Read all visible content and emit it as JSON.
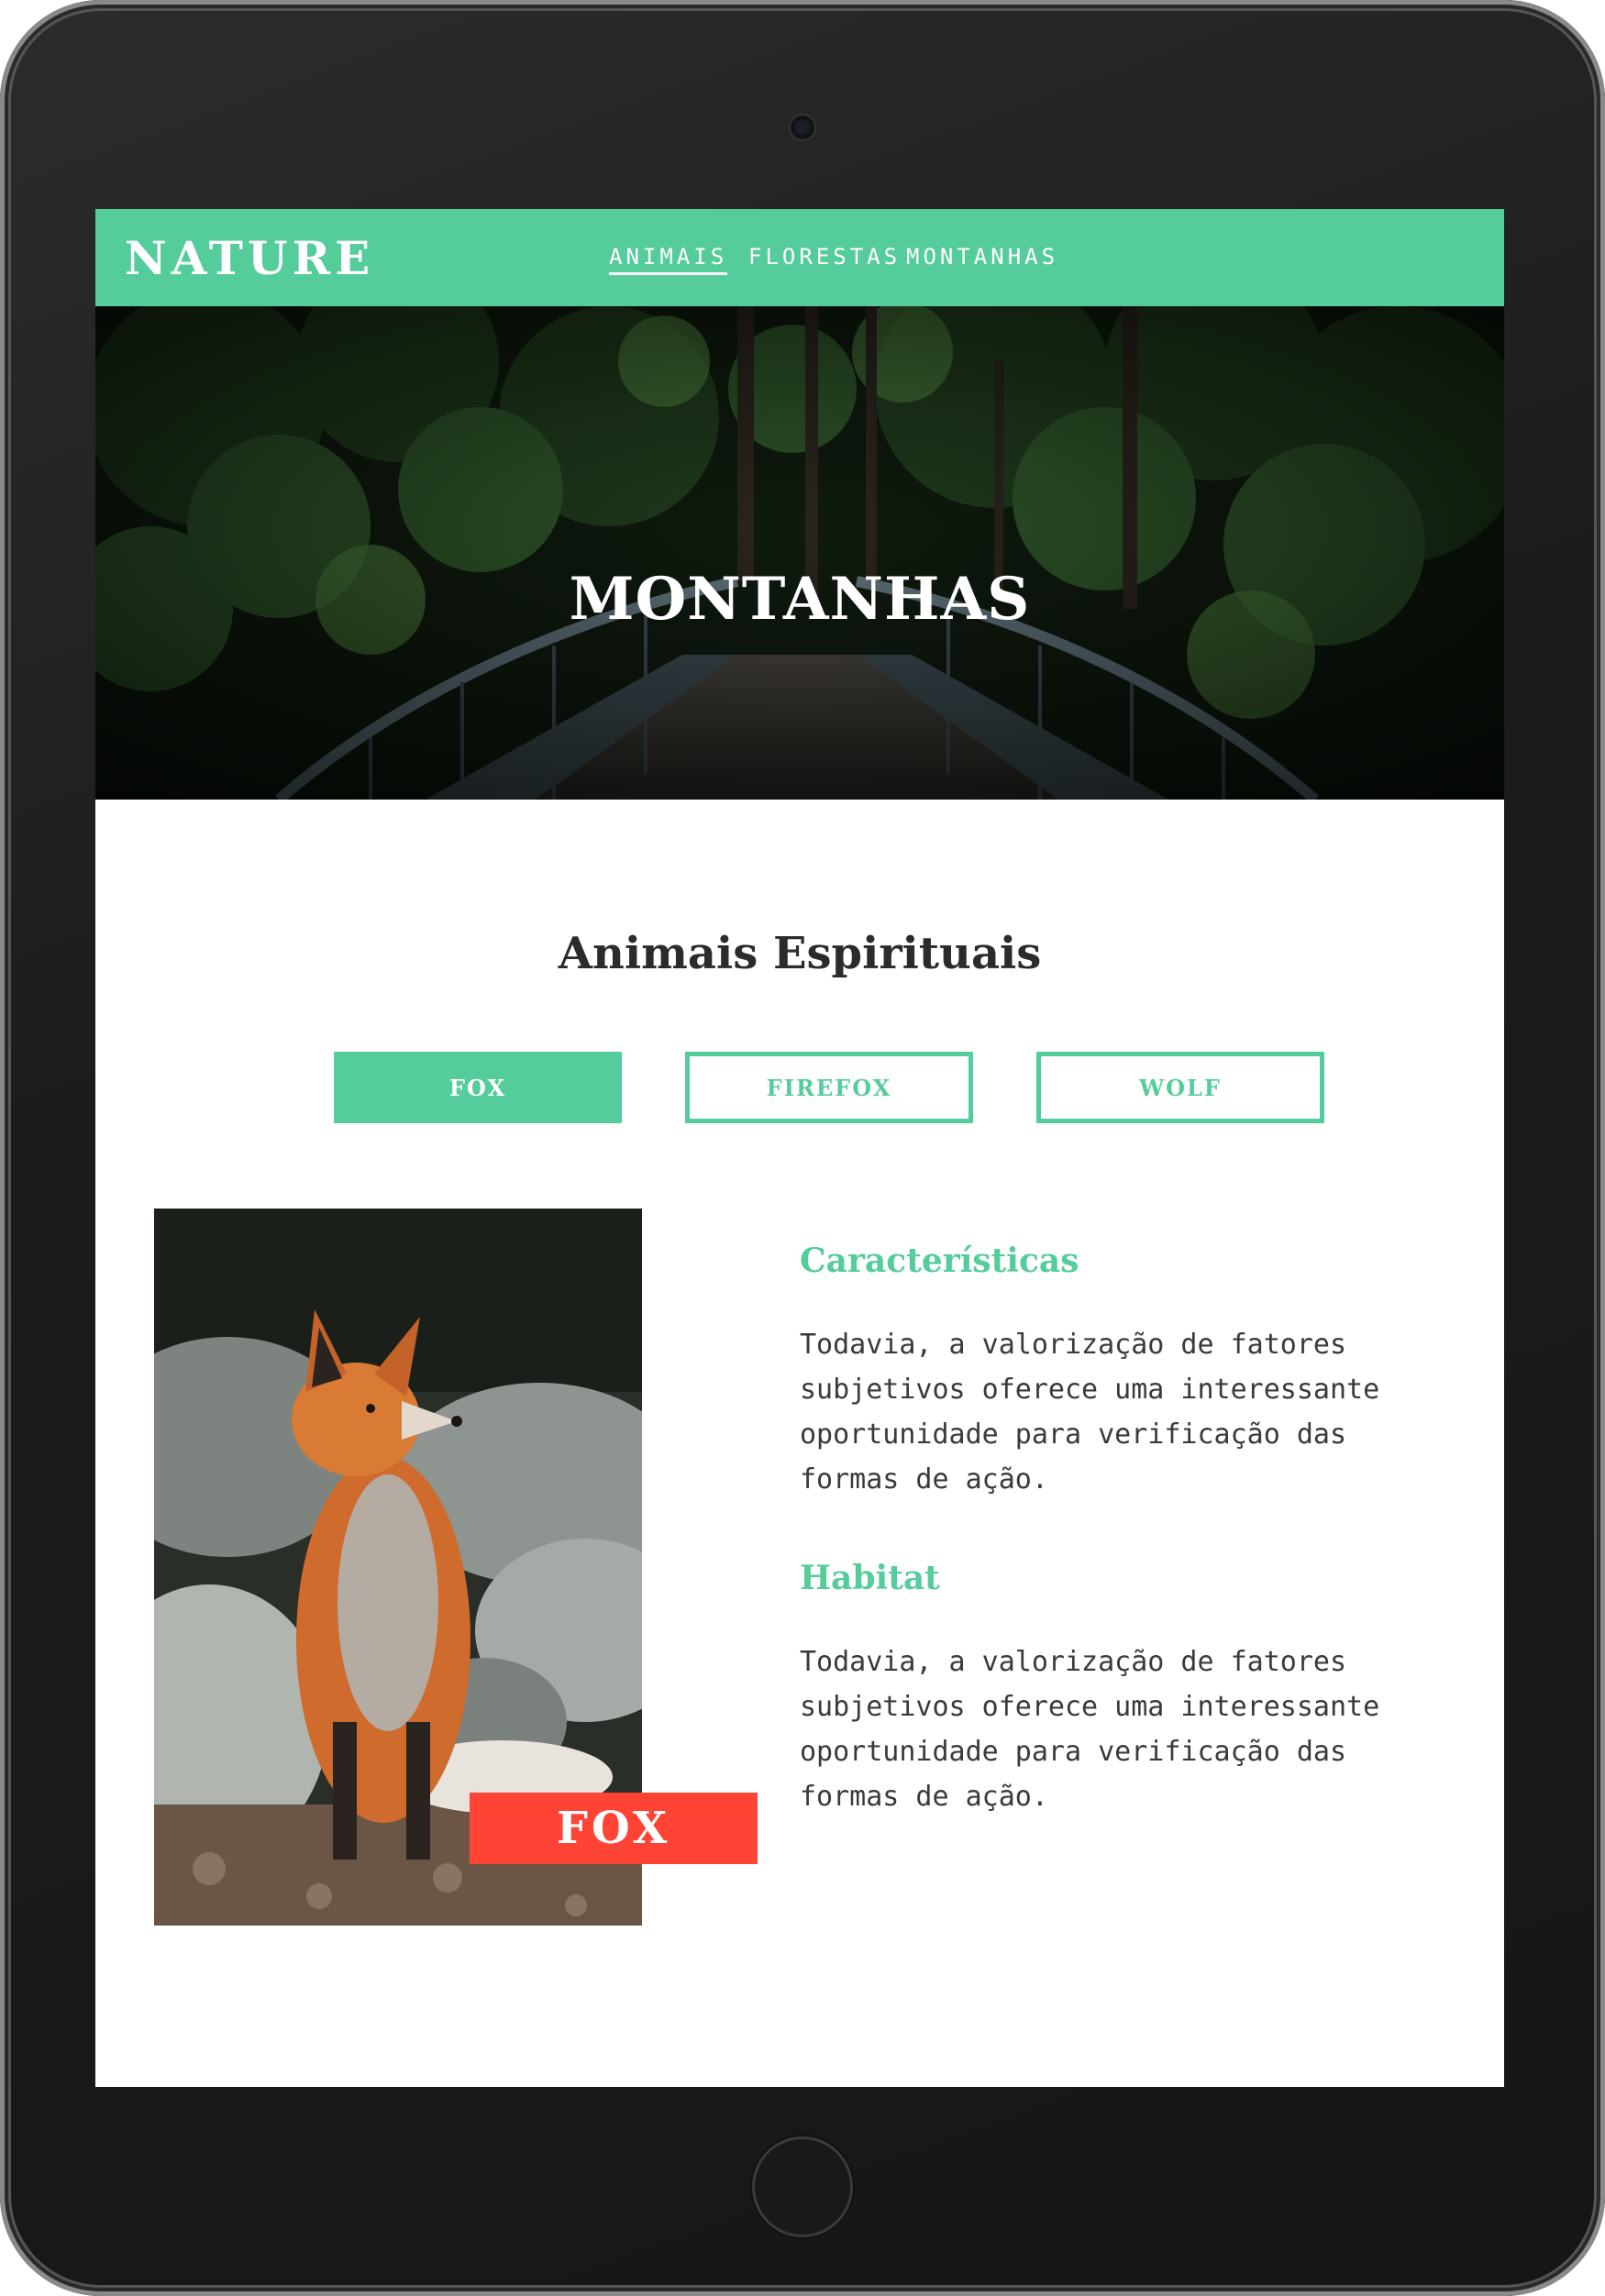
{
  "colors": {
    "accent": "#55cc9b",
    "badge": "#ff4436",
    "text": "#2b2b2b",
    "body_text": "#3a3a3a"
  },
  "nav": {
    "logo": "NATURE",
    "links": [
      {
        "label": "ANIMAIS",
        "active": true
      },
      {
        "label": "FLORESTAS",
        "active": false
      },
      {
        "label": "MONTANHAS",
        "active": false
      }
    ]
  },
  "hero": {
    "title": "MONTANHAS"
  },
  "section": {
    "title": "Animais Espirituais",
    "tabs": [
      {
        "label": "FOX",
        "active": true
      },
      {
        "label": "FIREFOX",
        "active": false
      },
      {
        "label": "WOLF",
        "active": false
      }
    ]
  },
  "animal": {
    "name": "FOX",
    "characteristics": {
      "heading": "Características",
      "text": "Todavia, a valorização de fatores subjetivos oferece uma interessante oportunidade para verificação das formas de ação."
    },
    "habitat": {
      "heading": "Habitat",
      "text": "Todavia, a valorização de fatores subjetivos oferece uma interessante oportunidade para verificação das formas de ação."
    }
  }
}
